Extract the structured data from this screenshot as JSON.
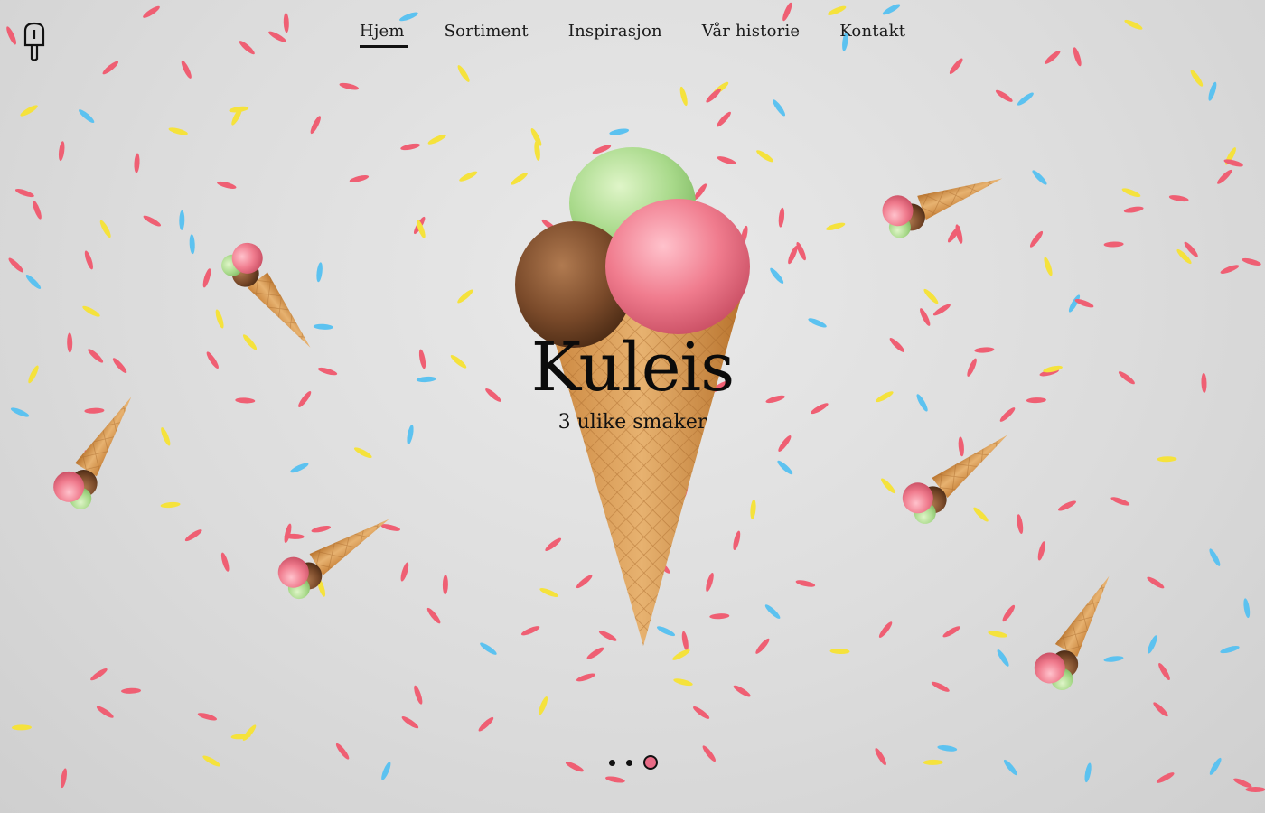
{
  "nav": {
    "items": [
      {
        "label": "Hjem",
        "active": true
      },
      {
        "label": "Sortiment",
        "active": false
      },
      {
        "label": "Inspirasjon",
        "active": false
      },
      {
        "label": "Vår historie",
        "active": false
      },
      {
        "label": "Kontakt",
        "active": false
      }
    ]
  },
  "logo": {
    "icon": "popsicle-icon"
  },
  "hero": {
    "title": "Kuleis",
    "subtitle": "3 ulike smaker"
  },
  "carousel": {
    "slides": 3,
    "active_index": 2
  },
  "colors": {
    "background": "#dcdcdc",
    "sprinkle_red": "#ef5f73",
    "sprinkle_blue": "#5cc2f0",
    "sprinkle_yellow": "#f5e23c",
    "scoop_pink": "#f07c8e",
    "scoop_chocolate": "#7a4a2a",
    "scoop_pistachio": "#a8d98a",
    "cone": "#d99a52"
  }
}
